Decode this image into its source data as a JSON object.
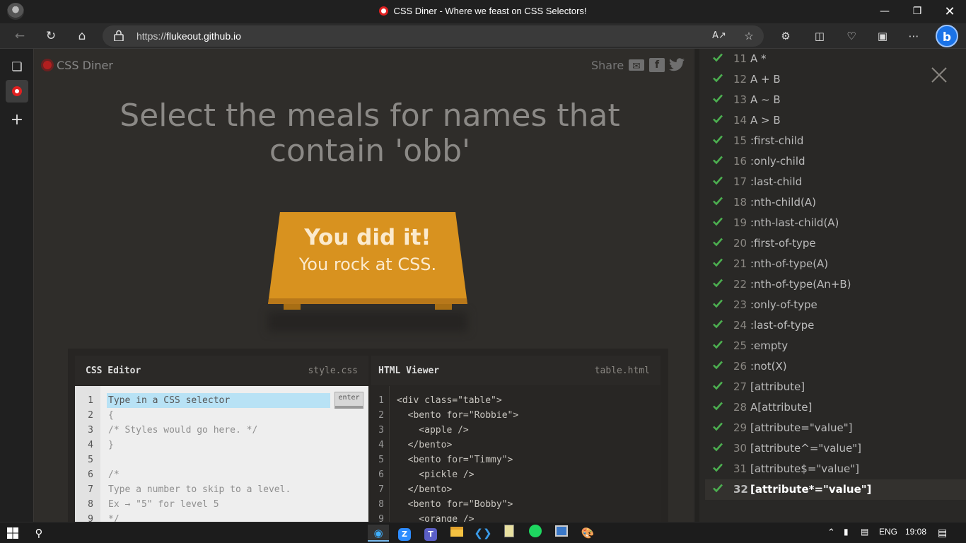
{
  "browser": {
    "window_title": "CSS Diner - Where we feast on CSS Selectors!",
    "url_prefix": "https://",
    "url_host": "flukeout.github.io"
  },
  "page": {
    "logo_text": "CSS Diner",
    "share_label": "Share",
    "headline": "Select the meals for names that contain 'obb'",
    "table_line1": "You did it!",
    "table_line2": "You rock at CSS."
  },
  "css_editor": {
    "title": "CSS Editor",
    "file": "style.css",
    "placeholder": "Type in a CSS selector",
    "enter_label": "enter",
    "lines": [
      "1",
      "2",
      "3",
      "4",
      "5",
      "6",
      "7",
      "8",
      "9"
    ],
    "code": [
      "",
      "{",
      "/* Styles would go here. */",
      "}",
      "",
      "/*",
      "Type a number to skip to a level.",
      "Ex → \"5\" for level 5",
      "*/"
    ]
  },
  "html_viewer": {
    "title": "HTML Viewer",
    "file": "table.html",
    "lines": [
      "1",
      "2",
      "3",
      "4",
      "5",
      "6",
      "7",
      "8",
      "9"
    ],
    "code": [
      "<div class=\"table\">",
      "  <bento for=\"Robbie\">",
      "    <apple />",
      "  </bento>",
      "  <bento for=\"Timmy\">",
      "    <pickle />",
      "  </bento>",
      "  <bento for=\"Bobby\">",
      "    <orange />"
    ]
  },
  "levels": [
    {
      "num": "11",
      "name": "A *"
    },
    {
      "num": "12",
      "name": "A + B"
    },
    {
      "num": "13",
      "name": "A ~ B"
    },
    {
      "num": "14",
      "name": "A > B"
    },
    {
      "num": "15",
      "name": ":first-child"
    },
    {
      "num": "16",
      "name": ":only-child"
    },
    {
      "num": "17",
      "name": ":last-child"
    },
    {
      "num": "18",
      "name": ":nth-child(A)"
    },
    {
      "num": "19",
      "name": ":nth-last-child(A)"
    },
    {
      "num": "20",
      "name": ":first-of-type"
    },
    {
      "num": "21",
      "name": ":nth-of-type(A)"
    },
    {
      "num": "22",
      "name": ":nth-of-type(An+B)"
    },
    {
      "num": "23",
      "name": ":only-of-type"
    },
    {
      "num": "24",
      "name": ":last-of-type"
    },
    {
      "num": "25",
      "name": ":empty"
    },
    {
      "num": "26",
      "name": ":not(X)"
    },
    {
      "num": "27",
      "name": "[attribute]"
    },
    {
      "num": "28",
      "name": "A[attribute]"
    },
    {
      "num": "29",
      "name": "[attribute=\"value\"]"
    },
    {
      "num": "30",
      "name": "[attribute^=\"value\"]"
    },
    {
      "num": "31",
      "name": "[attribute$=\"value\"]"
    },
    {
      "num": "32",
      "name": "[attribute*=\"value\"]"
    }
  ],
  "taskbar": {
    "language": "ENG",
    "time": "19:08"
  },
  "colors": {
    "check": "#4caf50",
    "table": "#d8921f",
    "accent_red": "#e02020"
  }
}
